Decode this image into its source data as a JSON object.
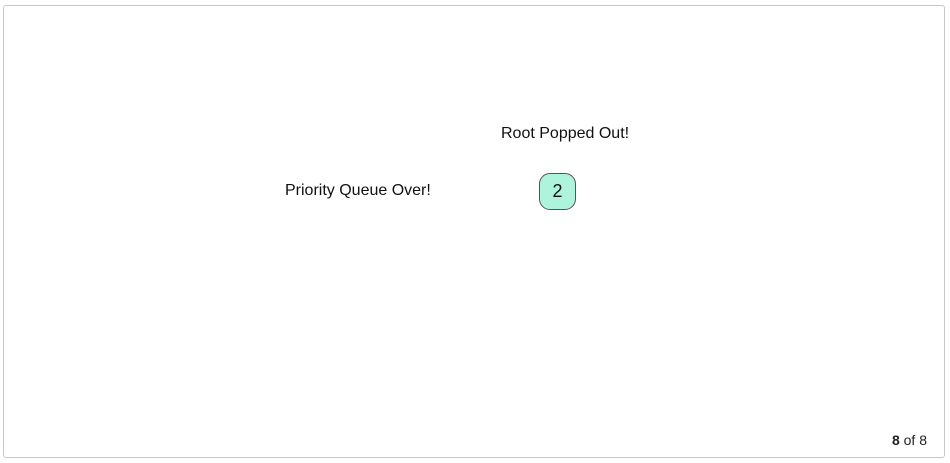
{
  "labels": {
    "root_popped": "Root Popped Out!",
    "queue_over": "Priority Queue Over!"
  },
  "node": {
    "value": "2",
    "fill_color": "#aef4dc",
    "border_color": "#555555"
  },
  "pagination": {
    "current": "8",
    "separator": "of",
    "total": "8"
  }
}
